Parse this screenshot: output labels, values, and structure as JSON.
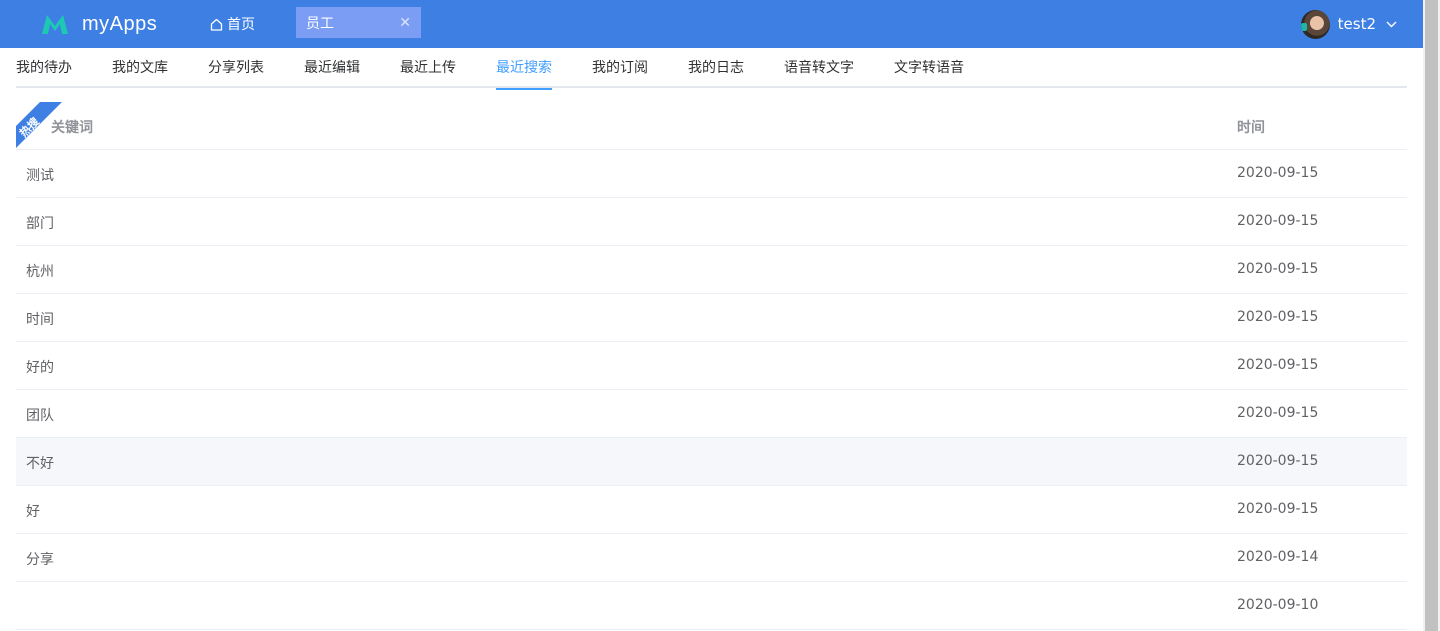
{
  "header": {
    "logo_text": "myApps",
    "home_label": "首页",
    "active_tab_label": "员工",
    "user_name": "test2",
    "accent_color": "#3d7fe3"
  },
  "tabs": [
    {
      "label": "我的待办"
    },
    {
      "label": "我的文库"
    },
    {
      "label": "分享列表"
    },
    {
      "label": "最近编辑"
    },
    {
      "label": "最近上传"
    },
    {
      "label": "最近搜索",
      "active": true
    },
    {
      "label": "我的订阅"
    },
    {
      "label": "我的日志"
    },
    {
      "label": "语音转文字"
    },
    {
      "label": "文字转语音"
    }
  ],
  "table": {
    "ribbon_label": "热搜",
    "columns": {
      "keyword": "关键词",
      "time": "时间"
    },
    "rows": [
      {
        "keyword": "测试",
        "time": "2020-09-15"
      },
      {
        "keyword": "部门",
        "time": "2020-09-15"
      },
      {
        "keyword": "杭州",
        "time": "2020-09-15"
      },
      {
        "keyword": "时间",
        "time": "2020-09-15"
      },
      {
        "keyword": "好的",
        "time": "2020-09-15"
      },
      {
        "keyword": "团队",
        "time": "2020-09-15"
      },
      {
        "keyword": "不好",
        "time": "2020-09-15"
      },
      {
        "keyword": "好",
        "time": "2020-09-15"
      },
      {
        "keyword": "分享",
        "time": "2020-09-14"
      },
      {
        "keyword": "",
        "time": "2020-09-10"
      }
    ]
  }
}
